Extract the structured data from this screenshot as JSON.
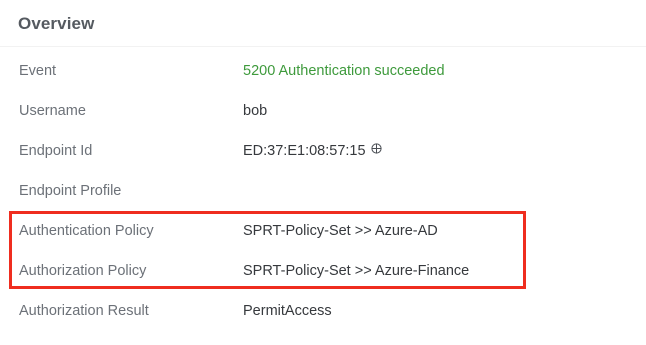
{
  "overview": {
    "title": "Overview",
    "rows": [
      {
        "label": "Event",
        "value": "5200 Authentication succeeded"
      },
      {
        "label": "Username",
        "value": "bob"
      },
      {
        "label": "Endpoint Id",
        "value": "ED:37:E1:08:57:15"
      },
      {
        "label": "Endpoint Profile",
        "value": ""
      },
      {
        "label": "Authentication Policy",
        "value": "SPRT-Policy-Set >> Azure-AD"
      },
      {
        "label": "Authorization Policy",
        "value": "SPRT-Policy-Set >> Azure-Finance"
      },
      {
        "label": "Authorization Result",
        "value": "PermitAccess"
      }
    ]
  },
  "icons": {
    "endpoint_locate": "crosshair-icon"
  },
  "colors": {
    "success": "#3e9a3c",
    "highlight": "#ef2d1f",
    "label": "#6c7178",
    "value": "#36393d"
  }
}
